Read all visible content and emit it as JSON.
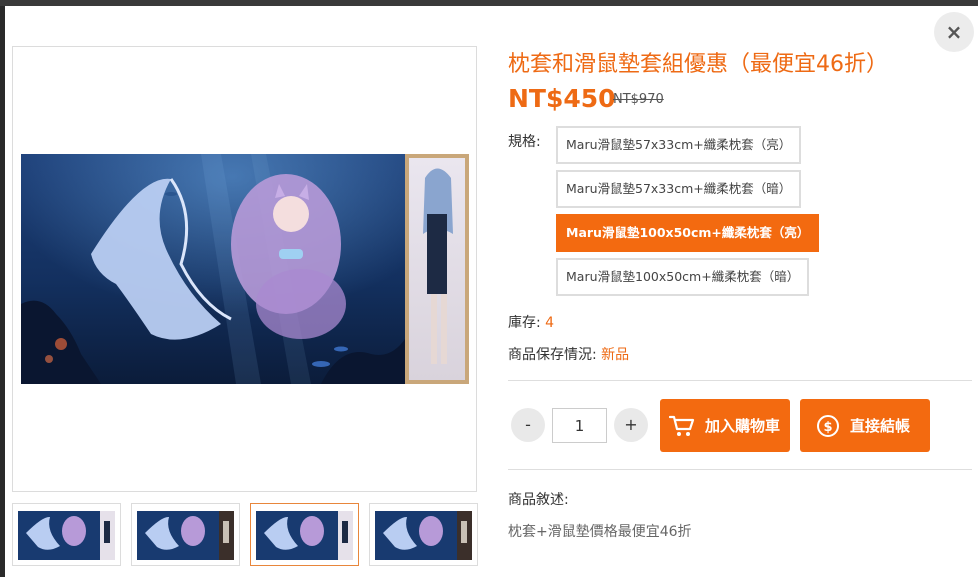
{
  "modal": {
    "close_label": "×"
  },
  "product": {
    "title": "枕套和滑鼠墊套組優惠（最便宜46折）",
    "price": "NT$450",
    "original_price": "NT$970",
    "spec_label": "規格:",
    "options": [
      {
        "label": "Maru滑鼠墊57x33cm+纖柔枕套（亮）",
        "selected": false
      },
      {
        "label": "Maru滑鼠墊57x33cm+纖柔枕套（暗）",
        "selected": false
      },
      {
        "label": "Maru滑鼠墊100x50cm+纖柔枕套（亮）",
        "selected": true
      },
      {
        "label": "Maru滑鼠墊100x50cm+纖柔枕套（暗）",
        "selected": false
      }
    ],
    "stock_label": "庫存:",
    "stock_value": "4",
    "condition_label": "商品保存情況:",
    "condition_value": "新品"
  },
  "purchase": {
    "minus_label": "-",
    "plus_label": "+",
    "quantity": "1",
    "add_to_cart_label": "加入購物車",
    "checkout_label": "直接結帳"
  },
  "description": {
    "label": "商品敘述:",
    "text": "枕套+滑鼠墊價格最便宜46折"
  },
  "gallery": {
    "thumbnail_count": 4,
    "active_thumbnail": 3
  },
  "colors": {
    "accent": "#f36a10",
    "title": "#ee6a14"
  },
  "icons": {
    "close": "close-icon",
    "cart": "cart-icon",
    "checkout": "dollar-coin-icon"
  }
}
